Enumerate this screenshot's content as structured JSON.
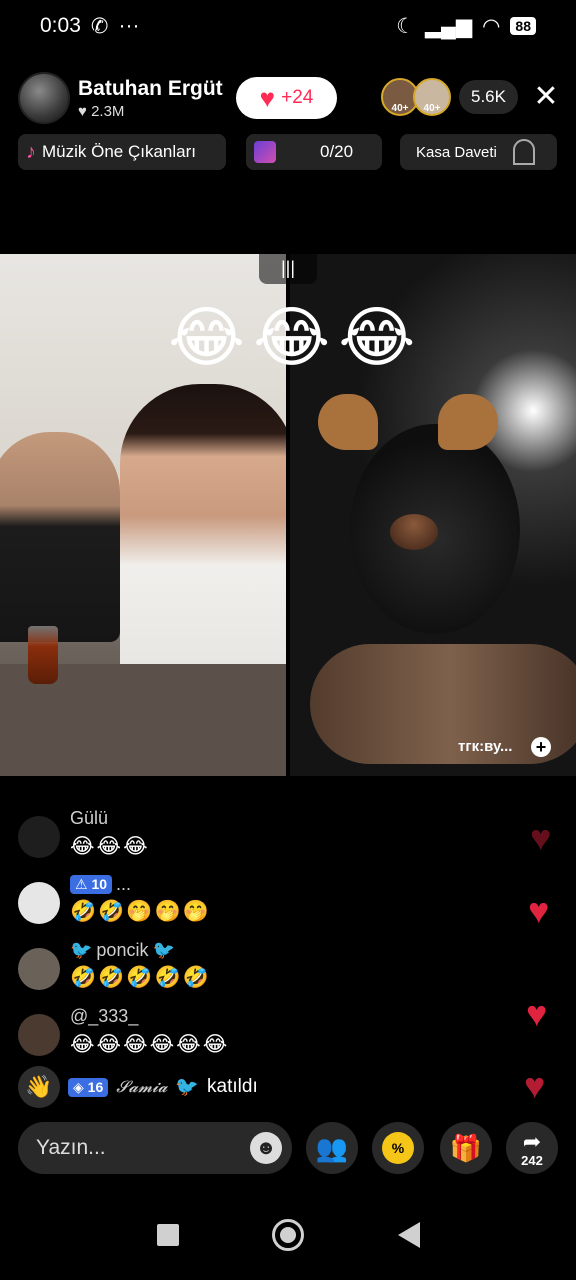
{
  "status_bar": {
    "time": "0:03",
    "whatsapp_icon": "whatsapp-icon",
    "more": "···",
    "battery": "88",
    "icons": [
      "moon-icon",
      "signal-icon",
      "wifi-icon"
    ]
  },
  "header": {
    "host_name": "Batuhan Ergüt",
    "host_likes": "♥ 2.3M",
    "follow_count": "+24",
    "viewer_badges": [
      "40+",
      "40+"
    ],
    "viewer_count": "5.6K",
    "close": "✕"
  },
  "pills": {
    "music": "Müzik Öne Çıkanları",
    "goal": "0/20",
    "box": "Kasa Daveti"
  },
  "video": {
    "split_handle": "|||",
    "emojis": "😂😂😂",
    "guest_label": "тгк:ву...",
    "guest_add": "+"
  },
  "chat": [
    {
      "name": "Gülü",
      "message": "😂😂😂",
      "avatar_color": "#1e1e1e"
    },
    {
      "name": "10",
      "suffix": "...",
      "level_icon": "⚠",
      "message": "🤣🤣🤭🤭🤭",
      "avatar_color": "#e6e6e6"
    },
    {
      "name": "poncik",
      "deco": "🐦",
      "message": "🤣🤣🤣🤣🤣",
      "avatar_color": "#6a6258"
    },
    {
      "name": "@_333_",
      "message": "😂😂😂😂😂😂",
      "avatar_color": "#4a3a30"
    }
  ],
  "join": {
    "level": "16",
    "level_icon": "◈",
    "name": "𝓢𝓪𝓶𝓲𝓪",
    "deco": "🐦",
    "text": "katıldı",
    "icon": "👋"
  },
  "toolbar": {
    "placeholder": "Yazın...",
    "emoji_icon": "☻",
    "multi_icon": "👥",
    "promo_icon": "%",
    "gift_icon": "🎁",
    "share_icon": "➦",
    "share_count": "242"
  },
  "colors": {
    "accent": "#fe2c55",
    "level_badge": "#3b6de3",
    "heart": "#e0233f"
  }
}
